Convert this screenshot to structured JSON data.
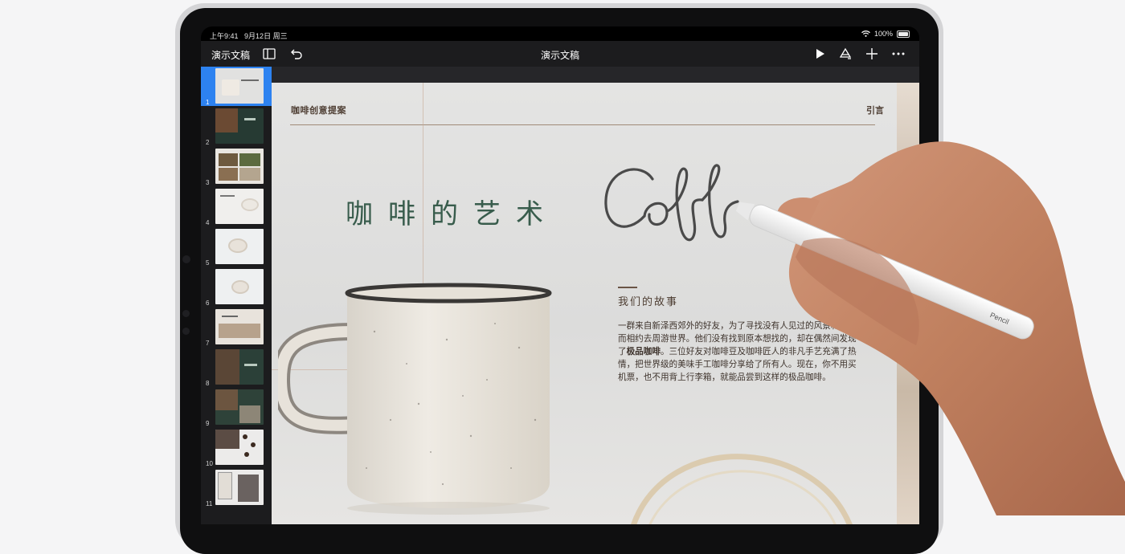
{
  "status_bar": {
    "time": "上午9:41",
    "date": "9月12日 周三",
    "battery": "100%"
  },
  "toolbar": {
    "doc_list_label": "演示文稿",
    "title": "演示文稿",
    "icons": [
      "sidebar-icon",
      "undo-icon",
      "play-icon",
      "format-brush-icon",
      "add-icon",
      "more-icon"
    ]
  },
  "navigator": {
    "selected": 1,
    "slides": [
      {
        "number": "1"
      },
      {
        "number": "2"
      },
      {
        "number": "3"
      },
      {
        "number": "4"
      },
      {
        "number": "5"
      },
      {
        "number": "6"
      },
      {
        "number": "7"
      },
      {
        "number": "8"
      },
      {
        "number": "9"
      },
      {
        "number": "10"
      },
      {
        "number": "11"
      }
    ]
  },
  "slide": {
    "header_left": "咖啡创意提案",
    "header_right": "引言",
    "title": "咖啡的艺术",
    "handwriting": "Coff",
    "story_title": "我们的故事",
    "story_body_1": "一群来自新泽西郊外的好友，为了寻找没有人见过的风景和奇遇而相约去周游世界。他们没有找到原本想找的，却在偶然间发现了",
    "story_body_bold": "极品咖啡",
    "story_body_2": "。三位好友对咖啡豆及咖啡匠人的非凡手艺充满了热情，把世界级的美味手工咖啡分享给了所有人。现在，你不用买机票，也不用背上行李箱，就能品尝到这样的极品咖啡。"
  },
  "pencil": {
    "brand": "Pencil"
  }
}
